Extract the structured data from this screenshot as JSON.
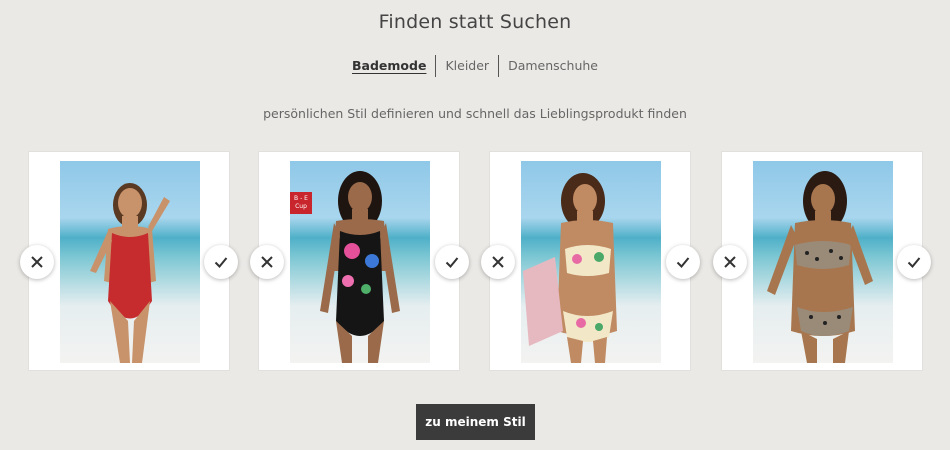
{
  "header": {
    "title": "Finden statt Suchen"
  },
  "tabs": [
    {
      "label": "Bademode",
      "active": true
    },
    {
      "label": "Kleider",
      "active": false
    },
    {
      "label": "Damenschuhe",
      "active": false
    }
  ],
  "subtitle": "persönlichen Stil definieren und schnell das Lieblingsprodukt finden",
  "products": [
    {
      "image": "red-one-piece-swimsuit",
      "reject_icon": "close-icon",
      "accept_icon": "check-icon"
    },
    {
      "image": "black-floral-swimsuit",
      "badge": "B - E Cup",
      "reject_icon": "close-icon",
      "accept_icon": "check-icon"
    },
    {
      "image": "floral-bikini",
      "reject_icon": "close-icon",
      "accept_icon": "check-icon"
    },
    {
      "image": "leopard-bikini",
      "reject_icon": "close-icon",
      "accept_icon": "check-icon"
    }
  ],
  "cta": {
    "label": "zu meinem Stil"
  },
  "colors": {
    "background": "#ebe9e6",
    "button": "#3b3b3b",
    "badge": "#c9252c"
  }
}
